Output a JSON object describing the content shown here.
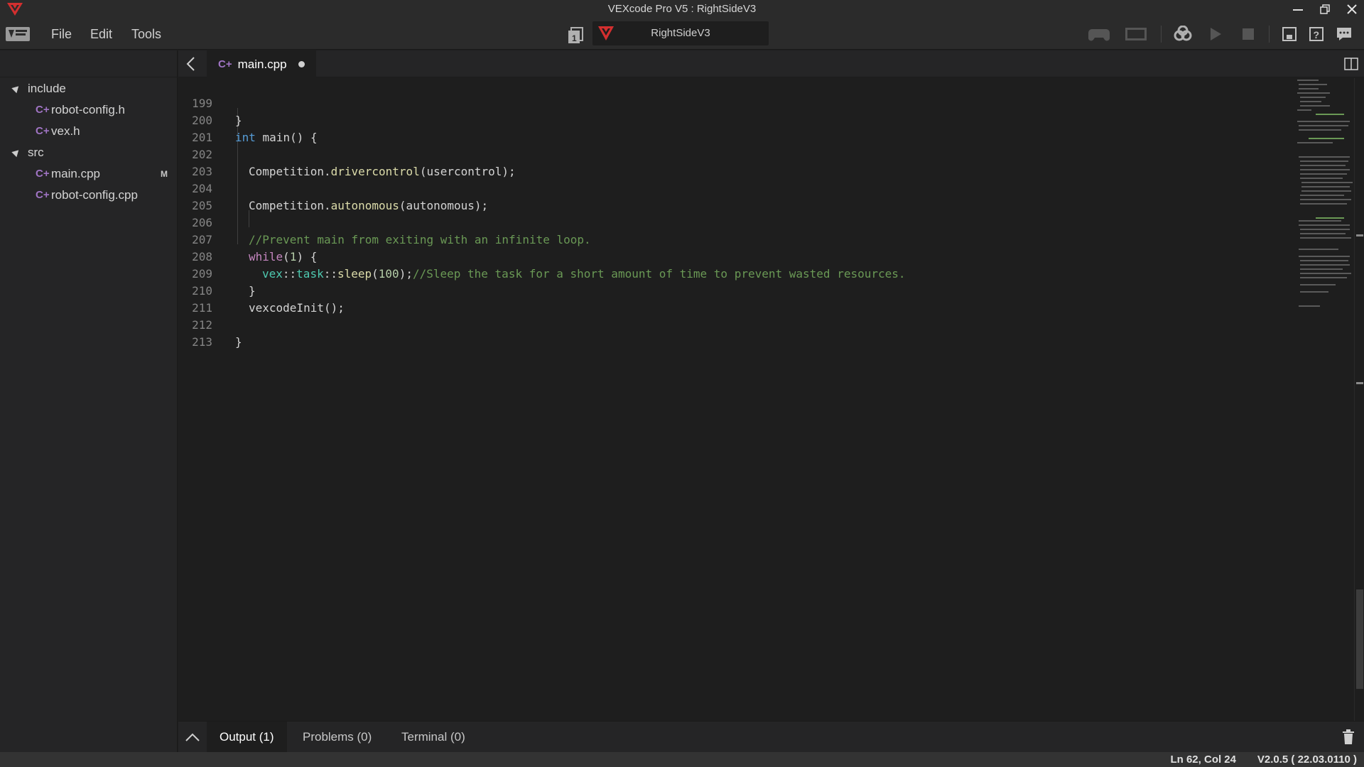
{
  "window": {
    "title": "VEXcode Pro V5 : RightSideV3"
  },
  "menu": {
    "items": [
      "File",
      "Edit",
      "Tools"
    ]
  },
  "project": {
    "name": "RightSideV3"
  },
  "toolbar": {
    "icons": [
      "controller-icon",
      "brain-screen-icon",
      "build-icon",
      "play-icon",
      "stop-icon",
      "devices-icon",
      "help-icon",
      "feedback-icon"
    ]
  },
  "sidebar": {
    "tree": [
      {
        "label": "include",
        "type": "folder"
      },
      {
        "label": "robot-config.h",
        "type": "file"
      },
      {
        "label": "vex.h",
        "type": "file"
      },
      {
        "label": "src",
        "type": "folder"
      },
      {
        "label": "main.cpp",
        "type": "file",
        "badge": "M"
      },
      {
        "label": "robot-config.cpp",
        "type": "file"
      }
    ],
    "file_icon_glyph": "C+"
  },
  "editor": {
    "tab_label": "main.cpp",
    "file_icon_glyph": "C+",
    "lines": [
      {
        "n": "199"
      },
      {
        "n": "200"
      },
      {
        "n": "201"
      },
      {
        "n": "202"
      },
      {
        "n": "203"
      },
      {
        "n": "204"
      },
      {
        "n": "205"
      },
      {
        "n": "206"
      },
      {
        "n": "207"
      },
      {
        "n": "208"
      },
      {
        "n": "209"
      },
      {
        "n": "210"
      },
      {
        "n": "211"
      },
      {
        "n": "212"
      },
      {
        "n": "213"
      }
    ],
    "code": {
      "l199": "}",
      "l200_kw": "int",
      "l200_rest": " main() {",
      "l202_obj": "Competition.",
      "l202_fn": "drivercontrol",
      "l202_rest": "(usercontrol);",
      "l204_obj": "Competition.",
      "l204_fn": "autonomous",
      "l204_rest": "(autonomous);",
      "l206_comment": "//Prevent main from exiting with an infinite loop.",
      "l207_kw": "while",
      "l207_open": "(",
      "l207_num": "1",
      "l207_rest": ") {",
      "l208_ns1": "vex",
      "l208_sep1": "::",
      "l208_ns2": "task",
      "l208_sep2": "::",
      "l208_fn": "sleep",
      "l208_open": "(",
      "l208_num": "100",
      "l208_close": ");",
      "l208_comment": "//Sleep the task for a short amount of time to prevent wasted resources.",
      "l209": "}",
      "l210": "vexcodeInit();",
      "l212": "}"
    }
  },
  "panel": {
    "tabs": [
      "Output (1)",
      "Problems (0)",
      "Terminal (0)"
    ],
    "active_tab": "Output (1)"
  },
  "status": {
    "cursor": "Ln 62, Col 24",
    "version": "V2.0.5 ( 22.03.0110 )"
  },
  "colors": {
    "accent": "#d32f2f",
    "background": "#1e1e1e",
    "keyword": "#569cd6",
    "function": "#dcdcaa",
    "comment": "#6a9955",
    "file_icon": "#a074c4"
  }
}
